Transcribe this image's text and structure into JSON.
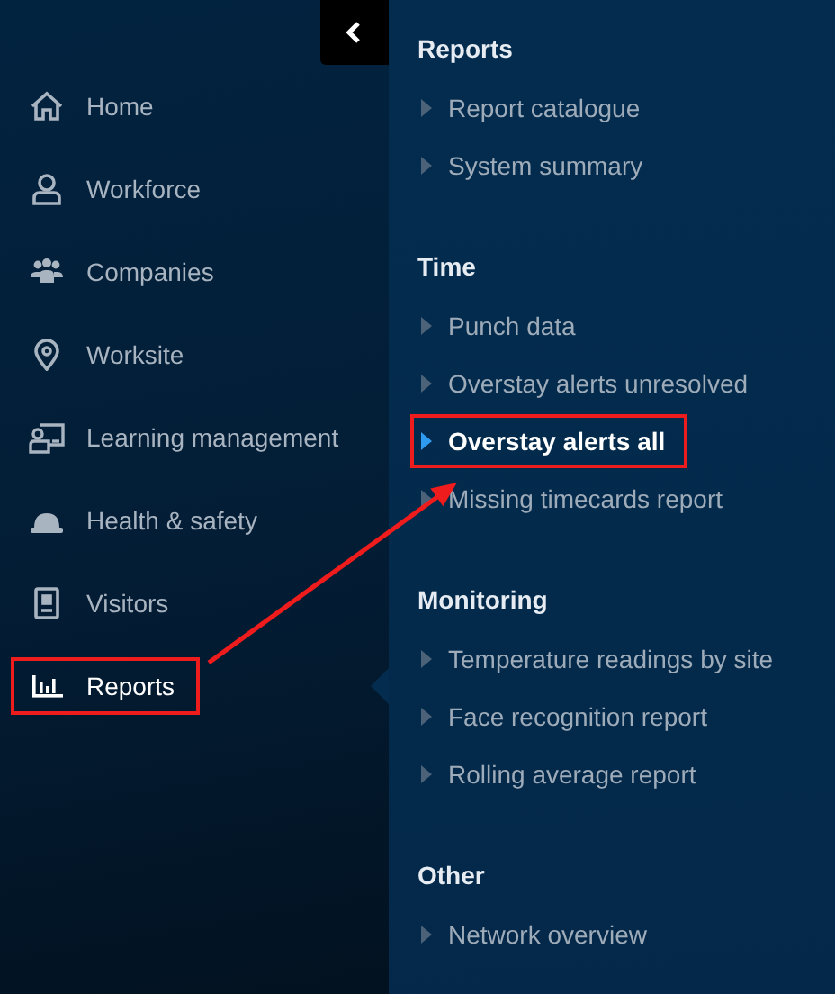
{
  "nav_items": [
    {
      "label": "Home",
      "selected": false,
      "highlighted": false
    },
    {
      "label": "Workforce",
      "selected": false,
      "highlighted": false
    },
    {
      "label": "Companies",
      "selected": false,
      "highlighted": false
    },
    {
      "label": "Worksite",
      "selected": false,
      "highlighted": false
    },
    {
      "label": "Learning management",
      "selected": false,
      "highlighted": false
    },
    {
      "label": "Health & safety",
      "selected": false,
      "highlighted": false
    },
    {
      "label": "Visitors",
      "selected": false,
      "highlighted": false
    },
    {
      "label": "Reports",
      "selected": true,
      "highlighted": true
    }
  ],
  "submenu": [
    {
      "heading": "Reports",
      "items": [
        {
          "label": "Report catalogue",
          "selected": false,
          "highlighted": false
        },
        {
          "label": "System summary",
          "selected": false,
          "highlighted": false
        }
      ]
    },
    {
      "heading": "Time",
      "items": [
        {
          "label": "Punch data",
          "selected": false,
          "highlighted": false
        },
        {
          "label": "Overstay alerts unresolved",
          "selected": false,
          "highlighted": false
        },
        {
          "label": "Overstay alerts all",
          "selected": true,
          "highlighted": true
        },
        {
          "label": "Missing timecards report",
          "selected": false,
          "highlighted": false
        }
      ]
    },
    {
      "heading": "Monitoring",
      "items": [
        {
          "label": "Temperature readings by site",
          "selected": false,
          "highlighted": false
        },
        {
          "label": "Face recognition report",
          "selected": false,
          "highlighted": false
        },
        {
          "label": "Rolling average report",
          "selected": false,
          "highlighted": false
        }
      ]
    },
    {
      "heading": "Other",
      "items": [
        {
          "label": "Network overview",
          "selected": false,
          "highlighted": false
        }
      ]
    }
  ]
}
